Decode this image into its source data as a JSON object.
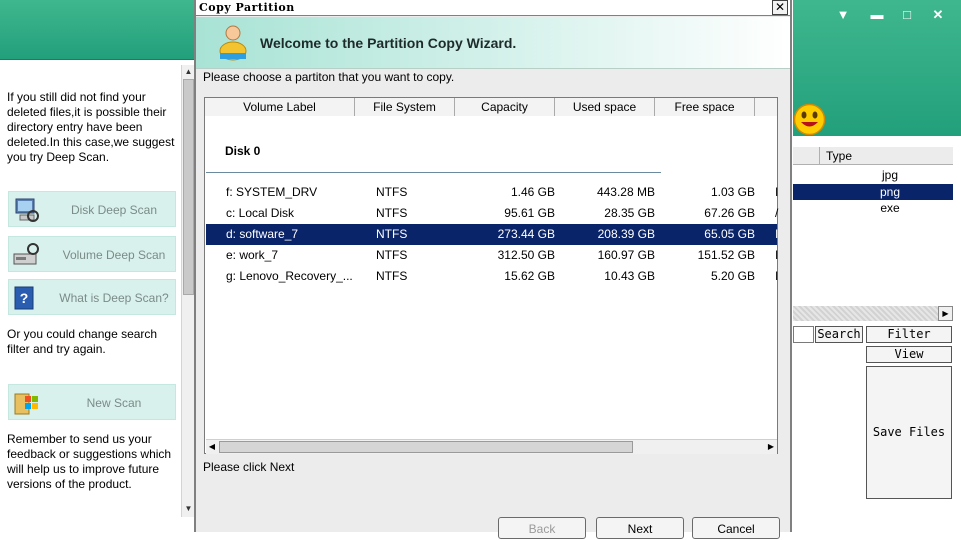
{
  "left_panel": {
    "intro_text": "If you still did not find your deleted files,it is possible their directory entry have been deleted.In this case,we suggest you try Deep Scan.",
    "buttons": [
      {
        "label": "Disk Deep Scan",
        "icon": "computer-icon"
      },
      {
        "label": "Volume Deep Scan",
        "icon": "drive-icon"
      },
      {
        "label": "What is Deep Scan?",
        "icon": "help-book-icon"
      }
    ],
    "filter_text": "Or you could change search filter and try again.",
    "new_scan_label": "New Scan",
    "feedback_text": "Remember to send us your feedback or suggestions which will help us to improve future versions of the product."
  },
  "right_panel": {
    "window_controls": [
      "▼",
      "▬",
      "□",
      "✕"
    ],
    "type_column_header": "Type",
    "types": [
      {
        "value": "jpg",
        "selected": false
      },
      {
        "value": "png",
        "selected": true
      },
      {
        "value": "exe",
        "selected": false
      }
    ],
    "search_label": "Search",
    "filter_label": "Filter",
    "view_label": "View",
    "save_files_label": "Save Files"
  },
  "dialog": {
    "title": "Copy Partition",
    "close_glyph": "✕",
    "banner_title": "Welcome to the Partition Copy Wizard.",
    "instruction": "Please choose a partiton that you want to copy.",
    "columns": [
      "Volume Label",
      "File System",
      "Capacity",
      "Used space",
      "Free space"
    ],
    "disk_label": "Disk 0",
    "partitions": [
      {
        "volume": "f: SYSTEM_DRV",
        "fs": "NTFS",
        "capacity": "1.46 GB",
        "used": "443.28 MB",
        "free": "1.03 GB",
        "more": "I",
        "selected": false
      },
      {
        "volume": "c: Local Disk",
        "fs": "NTFS",
        "capacity": "95.61 GB",
        "used": "28.35 GB",
        "free": "67.26 GB",
        "more": "/",
        "selected": false
      },
      {
        "volume": "d: software_7",
        "fs": "NTFS",
        "capacity": "273.44 GB",
        "used": "208.39 GB",
        "free": "65.05 GB",
        "more": "I",
        "selected": true
      },
      {
        "volume": "e: work_7",
        "fs": "NTFS",
        "capacity": "312.50 GB",
        "used": "160.97 GB",
        "free": "151.52 GB",
        "more": "I",
        "selected": false
      },
      {
        "volume": "g: Lenovo_Recovery_...",
        "fs": "NTFS",
        "capacity": "15.62 GB",
        "used": "10.43 GB",
        "free": "5.20 GB",
        "more": "I",
        "selected": false
      }
    ],
    "status": "Please click Next",
    "back_label": "Back",
    "next_label": "Next",
    "cancel_label": "Cancel"
  }
}
